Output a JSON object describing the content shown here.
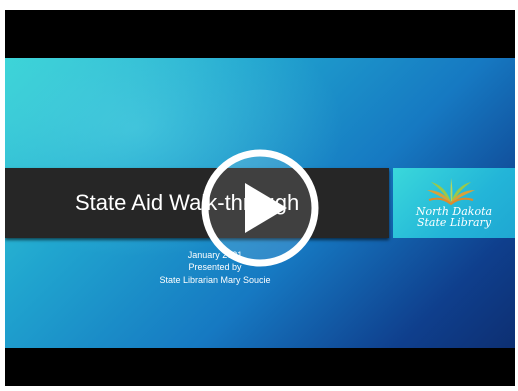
{
  "slide": {
    "title": "State Aid Walk-through",
    "subtitle_lines": [
      "January 2021",
      "Presented by",
      "State Librarian Mary Soucie"
    ]
  },
  "logo": {
    "line1": "North Dakota",
    "line2": "State Library"
  },
  "player": {
    "play_icon": "play-icon"
  }
}
